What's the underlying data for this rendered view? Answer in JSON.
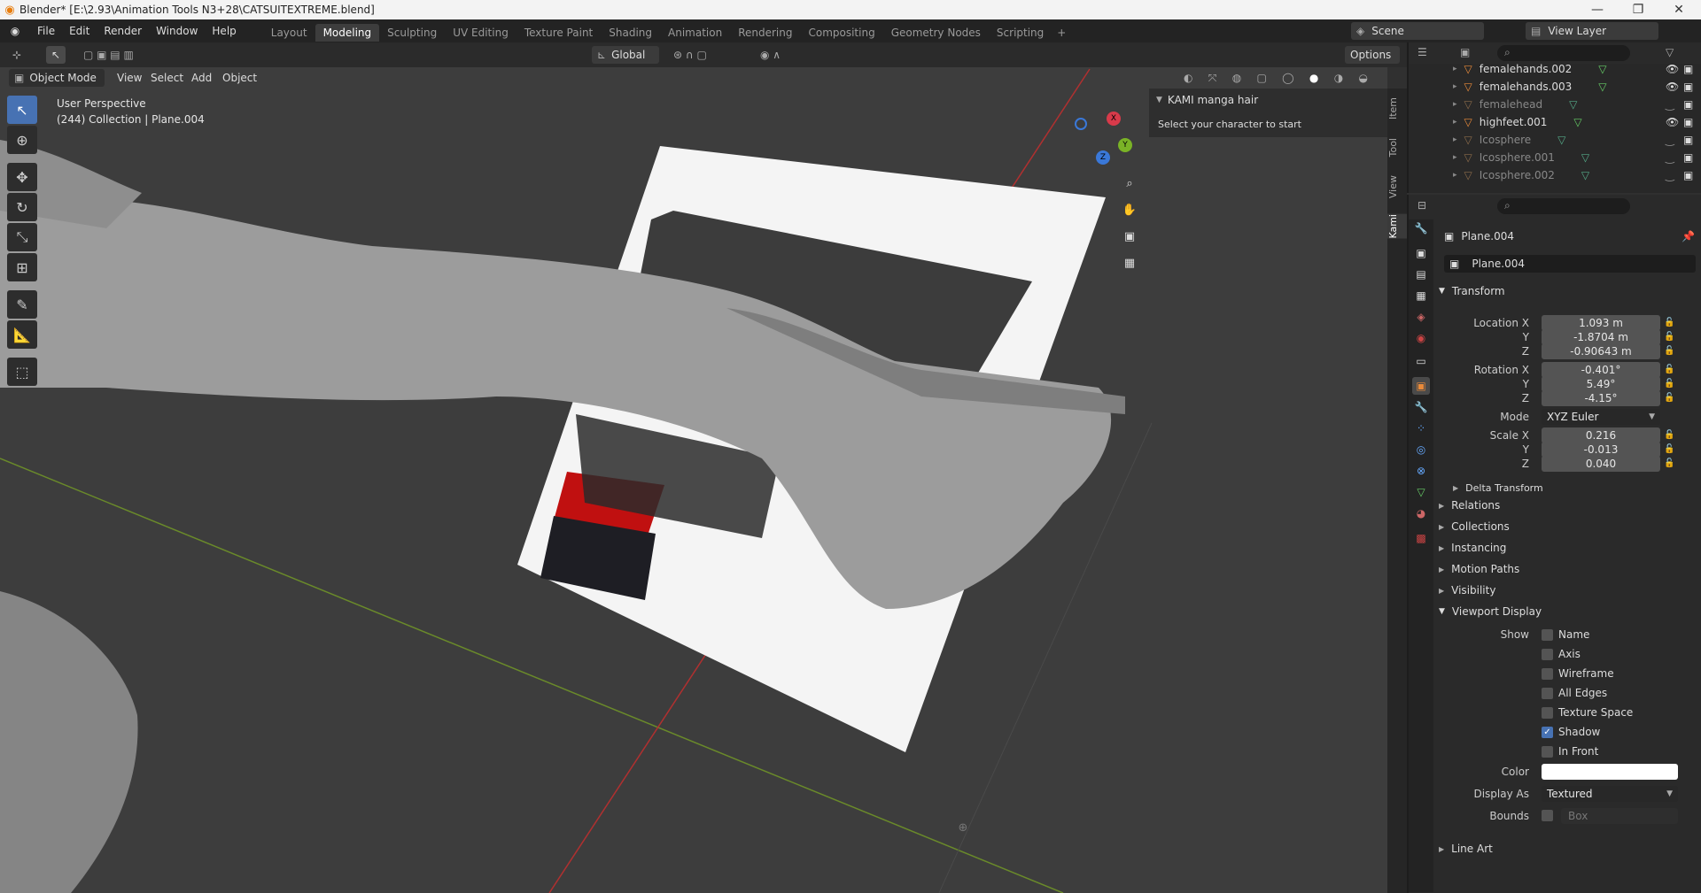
{
  "titlebar": {
    "title": "Blender* [E:\\2.93\\Animation Tools N3+28\\CATSUITEXTREME.blend]",
    "minimize": "—",
    "maximize": "❐",
    "close": "✕"
  },
  "menubar": {
    "menus": [
      "File",
      "Edit",
      "Render",
      "Window",
      "Help"
    ],
    "workspaces": [
      "Layout",
      "Modeling",
      "Sculpting",
      "UV Editing",
      "Texture Paint",
      "Shading",
      "Animation",
      "Rendering",
      "Compositing",
      "Geometry Nodes",
      "Scripting"
    ],
    "active_workspace": "Modeling",
    "add_tab": "+",
    "scene": "Scene",
    "view_layer": "View Layer"
  },
  "viewport_header": {
    "mode": "Object Mode",
    "menus": [
      "View",
      "Select",
      "Add",
      "Object"
    ],
    "orientation": "Global",
    "options": "Options"
  },
  "viewport": {
    "perspective": "User Perspective",
    "collection": "(244) Collection | Plane.004",
    "gizmo_axes": [
      "X",
      "Y",
      "Z"
    ]
  },
  "npanel": {
    "title": "KAMI manga hair",
    "text": "Select your character to start",
    "tabs": [
      "Item",
      "Tool",
      "View",
      "Kami"
    ]
  },
  "outliner": {
    "items": [
      {
        "name": "femalehands.002",
        "visible": true,
        "dim": false
      },
      {
        "name": "femalehands.003",
        "visible": true,
        "dim": false
      },
      {
        "name": "femalehead",
        "visible": false,
        "dim": true
      },
      {
        "name": "highfeet.001",
        "visible": true,
        "dim": false
      },
      {
        "name": "Icosphere",
        "visible": false,
        "dim": true
      },
      {
        "name": "Icosphere.001",
        "visible": false,
        "dim": true
      },
      {
        "name": "Icosphere.002",
        "visible": false,
        "dim": true
      }
    ]
  },
  "properties": {
    "object_name": "Plane.004",
    "datablock": "Plane.004",
    "transform_label": "Transform",
    "location": {
      "label_x": "Location X",
      "x": "1.093 m",
      "y": "-1.8704 m",
      "z": "-0.90643 m"
    },
    "rotation": {
      "label_x": "Rotation X",
      "x": "-0.401°",
      "y": "5.49°",
      "z": "-4.15°"
    },
    "mode_label": "Mode",
    "mode": "XYZ Euler",
    "scale": {
      "label_x": "Scale X",
      "x": "0.216",
      "y": "-0.013",
      "z": "0.040"
    },
    "axis_y": "Y",
    "axis_z": "Z",
    "delta": "Delta Transform",
    "sections": [
      "Relations",
      "Collections",
      "Instancing",
      "Motion Paths",
      "Visibility"
    ],
    "viewport_display": "Viewport Display",
    "show_label": "Show",
    "show_items": [
      {
        "label": "Name",
        "checked": false
      },
      {
        "label": "Axis",
        "checked": false
      },
      {
        "label": "Wireframe",
        "checked": false
      },
      {
        "label": "All Edges",
        "checked": false
      },
      {
        "label": "Texture Space",
        "checked": false
      },
      {
        "label": "Shadow",
        "checked": true
      },
      {
        "label": "In Front",
        "checked": false
      }
    ],
    "color_label": "Color",
    "color_value": "#ffffff",
    "display_as_label": "Display As",
    "display_as": "Textured",
    "bounds_label": "Bounds",
    "bounds": "Box",
    "line_art": "Line Art"
  }
}
